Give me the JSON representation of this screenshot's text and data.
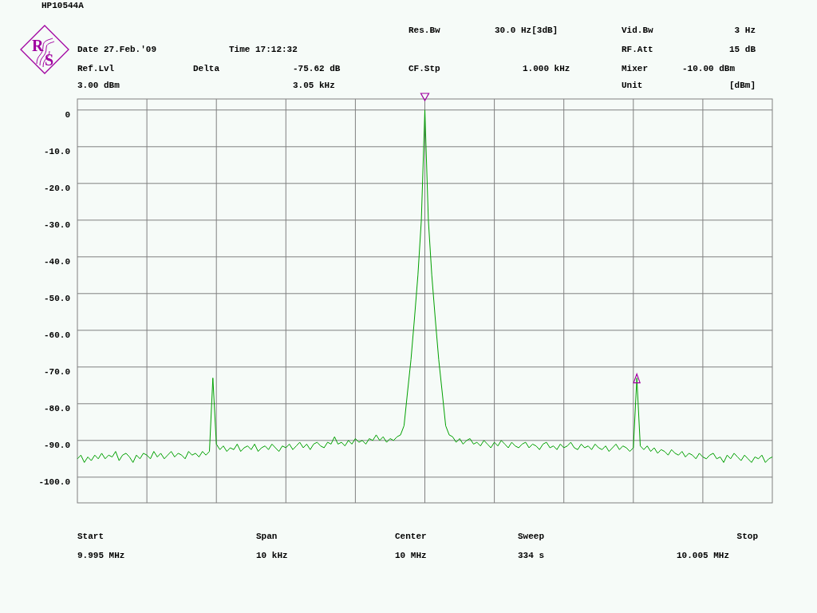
{
  "device_id": "HP10544A",
  "logo": {
    "letters": [
      "R",
      "S"
    ]
  },
  "header": {
    "res_bw_label": "Res.Bw",
    "res_bw_value": "30.0 Hz[3dB]",
    "vid_bw_label": "Vid.Bw",
    "vid_bw_value": "3 Hz",
    "date": "Date 27.Feb.'09",
    "time": "Time 17:12:32",
    "rf_att_label": "RF.Att",
    "rf_att_value": "15 dB",
    "ref_lvl_label": "Ref.Lvl",
    "delta_label": "Delta",
    "delta_level": "-75.62 dB",
    "cf_stp_label": "CF.Stp",
    "cf_stp_value": "1.000 kHz",
    "mixer_label": "Mixer",
    "mixer_value": "-10.00 dBm",
    "ref_lvl_value": "3.00 dBm",
    "delta_freq": "3.05 kHz",
    "unit_label": "Unit",
    "unit_value": "[dBm]"
  },
  "chart_data": {
    "type": "line",
    "grid": true,
    "ylim": [
      -107,
      3
    ],
    "categories": [
      null,
      null,
      null,
      null,
      null,
      null,
      null,
      null,
      null,
      null,
      null,
      null,
      null,
      null,
      null,
      null,
      null,
      null,
      null,
      null,
      null,
      null,
      null,
      null,
      null,
      null,
      null,
      null,
      null,
      null,
      null,
      null,
      null,
      null,
      null,
      null,
      null,
      null,
      null,
      null,
      null,
      null,
      null,
      null,
      null,
      null,
      null,
      null,
      null,
      null,
      null,
      null,
      null,
      null,
      null,
      null,
      null,
      null,
      null,
      null,
      null,
      null,
      null,
      null,
      null,
      null,
      null,
      null,
      null,
      null,
      null,
      null,
      null,
      null,
      null,
      null,
      null,
      null,
      null,
      null,
      null,
      null,
      null,
      null,
      null,
      null,
      null,
      null,
      null,
      null,
      null,
      null,
      null,
      null,
      null,
      null,
      null,
      null,
      null,
      null,
      null,
      null,
      null,
      null,
      null,
      null,
      null,
      null,
      null,
      null,
      null,
      null,
      null,
      null,
      null,
      null,
      null,
      null,
      null,
      null,
      null,
      null,
      null,
      null,
      null,
      null,
      null,
      null,
      null,
      null,
      null,
      null,
      null,
      null,
      null,
      null,
      null,
      null,
      null,
      null,
      null,
      null,
      null,
      null,
      null,
      null,
      null,
      null,
      null,
      null,
      null,
      null,
      null,
      null,
      null,
      null,
      null,
      null,
      null,
      null,
      null,
      null,
      null,
      null,
      null,
      null,
      null,
      null,
      null,
      null,
      null,
      null,
      null,
      null,
      null,
      null,
      null,
      null,
      null,
      null,
      null,
      null,
      null,
      null,
      null,
      null,
      null,
      null,
      null,
      null,
      null,
      null,
      null,
      null,
      null,
      null,
      null,
      null,
      null,
      null,
      null
    ],
    "yticks": [
      {
        "value": 0,
        "label": "0"
      },
      {
        "value": -10,
        "label": "-10.0"
      },
      {
        "value": -20,
        "label": "-20.0"
      },
      {
        "value": -30,
        "label": "-30.0"
      },
      {
        "value": -40,
        "label": "-40.0"
      },
      {
        "value": -50,
        "label": "-50.0"
      },
      {
        "value": -60,
        "label": "-60.0"
      },
      {
        "value": -70,
        "label": "-70.0"
      },
      {
        "value": -80,
        "label": "-80.0"
      },
      {
        "value": -90,
        "label": "-90.0"
      },
      {
        "value": -100,
        "label": "-100.0"
      }
    ],
    "series": [
      {
        "color": "#00a000",
        "values": [
          -95,
          -94,
          -96,
          -94.5,
          -95.5,
          -94,
          -95,
          -93.5,
          -95,
          -94,
          -94.5,
          -93,
          -95.5,
          -94,
          -93.5,
          -94.5,
          -96,
          -94,
          -95,
          -93.5,
          -94,
          -95,
          -93,
          -94.5,
          -93.5,
          -95,
          -94,
          -93,
          -94.5,
          -93.5,
          -94,
          -95,
          -93,
          -94,
          -93.5,
          -94.5,
          -93,
          -94,
          -93,
          -73,
          -91,
          -92.5,
          -91.5,
          -93,
          -92,
          -92.5,
          -91,
          -93,
          -92,
          -91.5,
          -92.5,
          -91,
          -93,
          -92,
          -91.5,
          -92.5,
          -91,
          -92,
          -93,
          -91.5,
          -92,
          -91,
          -92.5,
          -91.5,
          -90.5,
          -92,
          -91,
          -92.5,
          -91,
          -90.5,
          -91.5,
          -92,
          -90.5,
          -91,
          -89,
          -91,
          -90.5,
          -91.5,
          -90,
          -91,
          -89.5,
          -90.5,
          -90,
          -91,
          -89.5,
          -90,
          -88.5,
          -90,
          -89,
          -90.5,
          -89.5,
          -90,
          -89,
          -88.5,
          -86,
          -77,
          -68,
          -57,
          -45,
          -30,
          0,
          -30,
          -45,
          -57,
          -68,
          -77,
          -86,
          -88.5,
          -89,
          -90.5,
          -89.5,
          -91,
          -90,
          -89.5,
          -91,
          -90.5,
          -91.5,
          -90,
          -91,
          -92,
          -90.5,
          -91.5,
          -90,
          -91,
          -92,
          -90.5,
          -91.5,
          -92,
          -91,
          -90.5,
          -92,
          -91,
          -91.5,
          -92.5,
          -91,
          -90.5,
          -92,
          -91.5,
          -92.5,
          -91,
          -92,
          -91.5,
          -90.5,
          -92,
          -92.5,
          -91,
          -92,
          -91.5,
          -92.5,
          -91,
          -92,
          -92.5,
          -91.5,
          -93,
          -92,
          -91,
          -92.5,
          -91.5,
          -92,
          -93,
          -92,
          -73,
          -91.5,
          -92.5,
          -91.5,
          -93,
          -92,
          -93.5,
          -92.5,
          -93,
          -94,
          -92.5,
          -93.5,
          -94,
          -93,
          -94.5,
          -93.5,
          -94,
          -95,
          -93.5,
          -94.5,
          -95,
          -94,
          -93.5,
          -95,
          -94.5,
          -96,
          -94,
          -95,
          -93.5,
          -94.5,
          -95.5,
          -94,
          -95,
          -96,
          -94.5,
          -95,
          -94,
          -96,
          -95,
          -94.5
        ]
      }
    ]
  },
  "footer": [
    {
      "label": "Start",
      "value": "9.995 MHz"
    },
    {
      "label": "Span",
      "value": "10 kHz"
    },
    {
      "label": "Center",
      "value": "10 MHz"
    },
    {
      "label": "Sweep",
      "value": "334 s"
    },
    {
      "label": "Stop",
      "value": "10.005 MHz"
    }
  ]
}
